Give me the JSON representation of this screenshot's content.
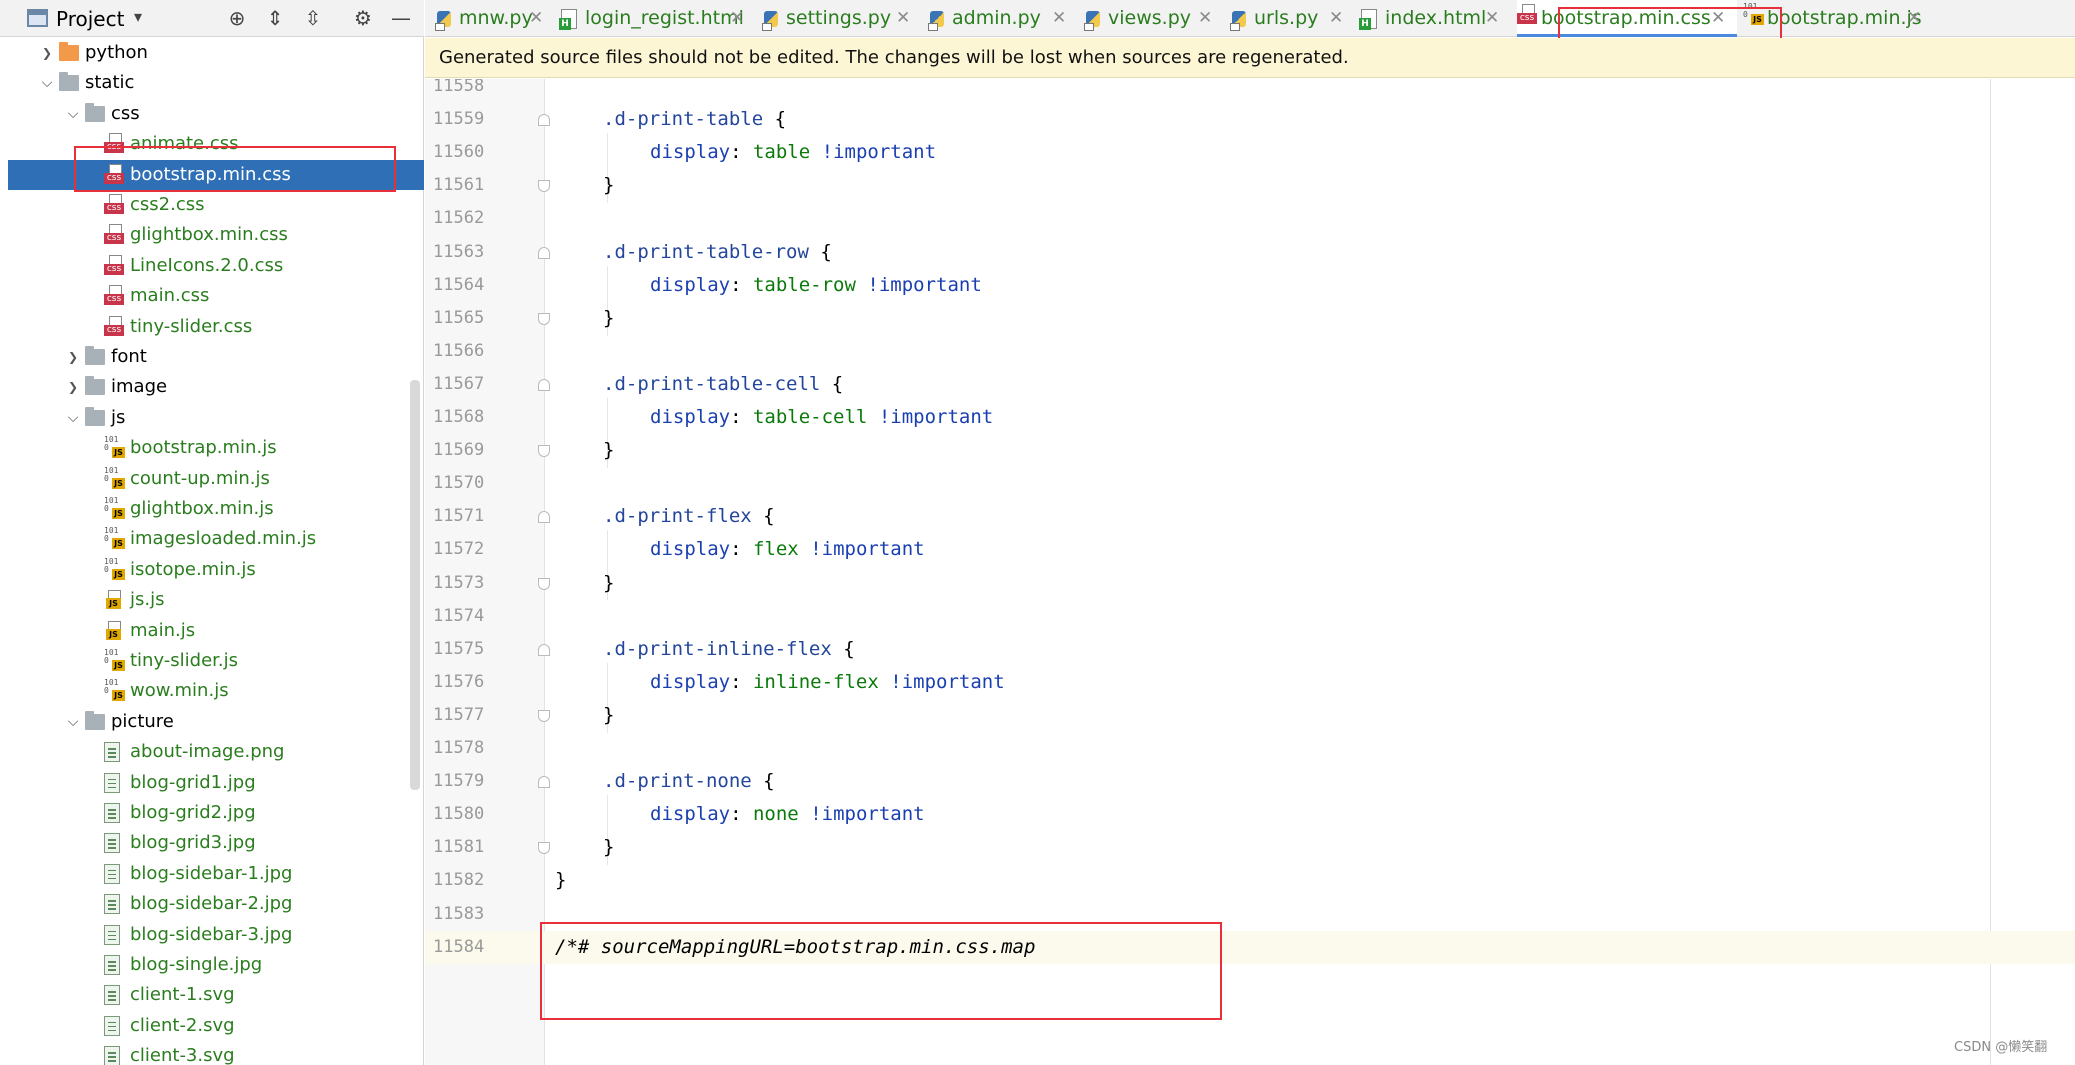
{
  "sidebar": {
    "title": "Project",
    "tree": [
      {
        "label": "python",
        "kind": "folder",
        "icon": "orange-folder-icon",
        "arrow": "›",
        "depth": 1
      },
      {
        "label": "static",
        "kind": "folder",
        "icon": "folder-icon",
        "arrow": "⌄",
        "depth": 1
      },
      {
        "label": "css",
        "kind": "folder",
        "icon": "folder-icon",
        "arrow": "⌄",
        "depth": 2
      },
      {
        "label": "animate.css",
        "kind": "css"
      },
      {
        "label": "bootstrap.min.css",
        "kind": "css",
        "selected": true
      },
      {
        "label": "css2.css",
        "kind": "css"
      },
      {
        "label": "glightbox.min.css",
        "kind": "css"
      },
      {
        "label": "LineIcons.2.0.css",
        "kind": "css"
      },
      {
        "label": "main.css",
        "kind": "css"
      },
      {
        "label": "tiny-slider.css",
        "kind": "css"
      },
      {
        "label": "font",
        "kind": "folder",
        "icon": "folder-icon",
        "arrow": "›",
        "depth": 2
      },
      {
        "label": "image",
        "kind": "folder",
        "icon": "folder-icon",
        "arrow": "›",
        "depth": 2
      },
      {
        "label": "js",
        "kind": "folder",
        "icon": "folder-icon",
        "arrow": "⌄",
        "depth": 2
      },
      {
        "label": "bootstrap.min.js",
        "kind": "jsmin"
      },
      {
        "label": "count-up.min.js",
        "kind": "jsmin"
      },
      {
        "label": "glightbox.min.js",
        "kind": "jsmin"
      },
      {
        "label": "imagesloaded.min.js",
        "kind": "jsmin"
      },
      {
        "label": "isotope.min.js",
        "kind": "jsmin"
      },
      {
        "label": "js.js",
        "kind": "js"
      },
      {
        "label": "main.js",
        "kind": "js"
      },
      {
        "label": "tiny-slider.js",
        "kind": "jsmin"
      },
      {
        "label": "wow.min.js",
        "kind": "jsmin"
      },
      {
        "label": "picture",
        "kind": "folder",
        "icon": "folder-icon",
        "arrow": "⌄",
        "depth": 2
      },
      {
        "label": "about-image.png",
        "kind": "img"
      },
      {
        "label": "blog-grid1.jpg",
        "kind": "img"
      },
      {
        "label": "blog-grid2.jpg",
        "kind": "img"
      },
      {
        "label": "blog-grid3.jpg",
        "kind": "img"
      },
      {
        "label": "blog-sidebar-1.jpg",
        "kind": "img"
      },
      {
        "label": "blog-sidebar-2.jpg",
        "kind": "img"
      },
      {
        "label": "blog-sidebar-3.jpg",
        "kind": "img"
      },
      {
        "label": "blog-single.jpg",
        "kind": "img"
      },
      {
        "label": "client-1.svg",
        "kind": "img"
      },
      {
        "label": "client-2.svg",
        "kind": "img"
      },
      {
        "label": "client-3.svg",
        "kind": "img"
      }
    ]
  },
  "tabs": [
    {
      "label": "mnw.py",
      "icon": "python-file-icon"
    },
    {
      "label": "login_regist.html",
      "icon": "html-file-icon"
    },
    {
      "label": "settings.py",
      "icon": "python-file-icon"
    },
    {
      "label": "admin.py",
      "icon": "python-file-icon"
    },
    {
      "label": "views.py",
      "icon": "python-file-icon"
    },
    {
      "label": "urls.py",
      "icon": "python-file-icon"
    },
    {
      "label": "index.html",
      "icon": "html-file-icon"
    },
    {
      "label": "bootstrap.min.css",
      "icon": "css-file-icon",
      "active": true
    },
    {
      "label": "bootstrap.min.js",
      "icon": "js-file-icon"
    }
  ],
  "notice": "Generated source files should not be edited. The changes will be lost when sources are regenerated.",
  "editor": {
    "lines": [
      {
        "n": "11558",
        "text": ""
      },
      {
        "n": "11559",
        "sel": ".d-print-table",
        "open": true
      },
      {
        "n": "11560",
        "prop": "display",
        "value": "table"
      },
      {
        "n": "11561",
        "close": true
      },
      {
        "n": "11562",
        "text": ""
      },
      {
        "n": "11563",
        "sel": ".d-print-table-row",
        "open": true
      },
      {
        "n": "11564",
        "prop": "display",
        "value": "table-row"
      },
      {
        "n": "11565",
        "close": true
      },
      {
        "n": "11566",
        "text": ""
      },
      {
        "n": "11567",
        "sel": ".d-print-table-cell",
        "open": true
      },
      {
        "n": "11568",
        "prop": "display",
        "value": "table-cell"
      },
      {
        "n": "11569",
        "close": true
      },
      {
        "n": "11570",
        "text": ""
      },
      {
        "n": "11571",
        "sel": ".d-print-flex",
        "open": true
      },
      {
        "n": "11572",
        "prop": "display",
        "value": "flex"
      },
      {
        "n": "11573",
        "close": true
      },
      {
        "n": "11574",
        "text": ""
      },
      {
        "n": "11575",
        "sel": ".d-print-inline-flex",
        "open": true
      },
      {
        "n": "11576",
        "prop": "display",
        "value": "inline-flex"
      },
      {
        "n": "11577",
        "close": true
      },
      {
        "n": "11578",
        "text": ""
      },
      {
        "n": "11579",
        "sel": ".d-print-none",
        "open": true
      },
      {
        "n": "11580",
        "prop": "display",
        "value": "none"
      },
      {
        "n": "11581",
        "close": true
      },
      {
        "n": "11582",
        "outer_close": "}"
      },
      {
        "n": "11583",
        "text": ""
      },
      {
        "n": "11584",
        "comment": "/*# sourceMappingURL=bootstrap.min.css.map",
        "current": true
      }
    ],
    "important": "!important"
  },
  "watermark": "CSDN @懒笑翻"
}
